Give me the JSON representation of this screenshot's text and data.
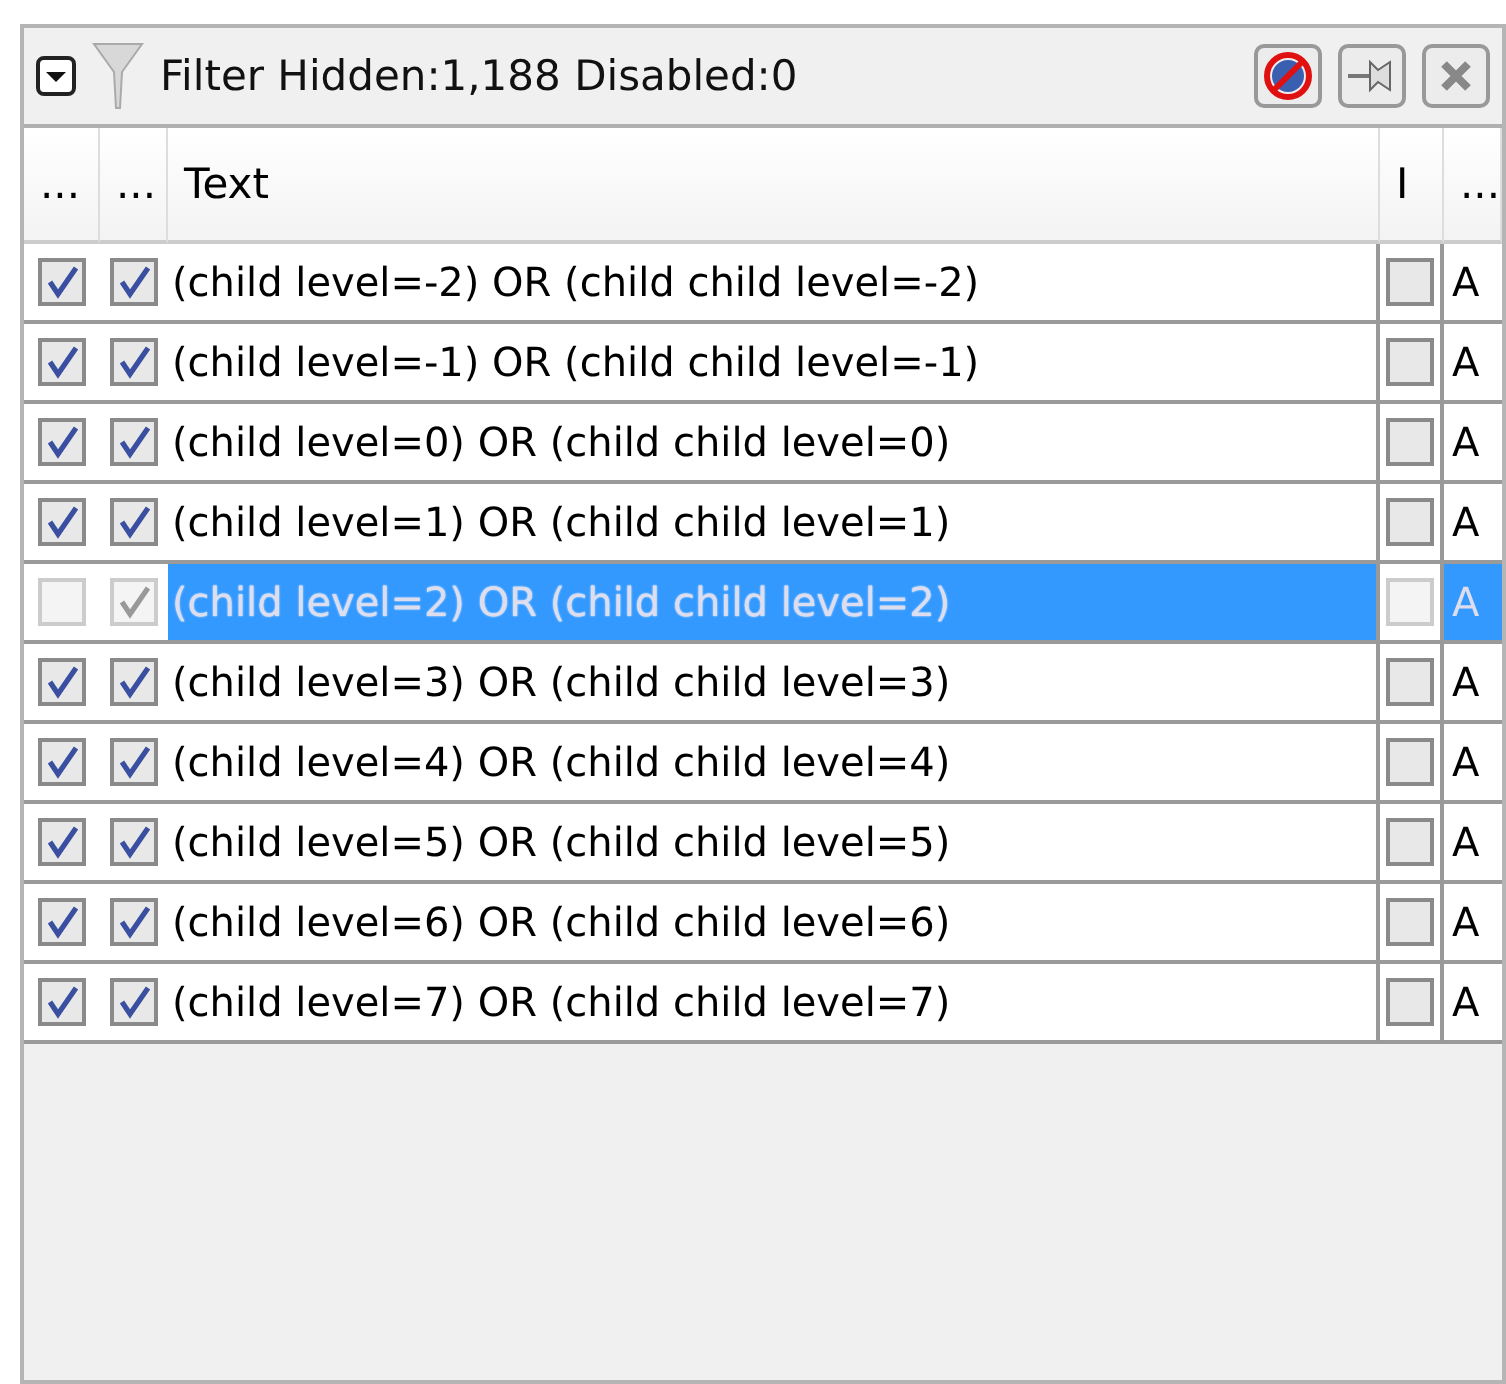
{
  "toolbar": {
    "expanded": true,
    "title": "Filter Hidden:1,188 Disabled:0"
  },
  "table": {
    "columns": [
      "...",
      "...",
      "Text",
      "I",
      "..."
    ],
    "rows": [
      {
        "enabled": true,
        "visible": true,
        "text": "(child level=-2) OR (child child level=-2)",
        "i_checked": false,
        "column_5": "A",
        "selected": false
      },
      {
        "enabled": true,
        "visible": true,
        "text": "(child level=-1) OR (child child level=-1)",
        "i_checked": false,
        "column_5": "A",
        "selected": false
      },
      {
        "enabled": true,
        "visible": true,
        "text": "(child level=0) OR (child child level=0)",
        "i_checked": false,
        "column_5": "A",
        "selected": false
      },
      {
        "enabled": true,
        "visible": true,
        "text": "(child level=1) OR (child child level=1)",
        "i_checked": false,
        "column_5": "A",
        "selected": false
      },
      {
        "enabled": false,
        "visible": true,
        "text": "(child level=2) OR (child child level=2)",
        "i_checked": false,
        "column_5": "A",
        "selected": true
      },
      {
        "enabled": true,
        "visible": true,
        "text": "(child level=3) OR (child child level=3)",
        "i_checked": false,
        "column_5": "A",
        "selected": false
      },
      {
        "enabled": true,
        "visible": true,
        "text": "(child level=4) OR (child child level=4)",
        "i_checked": false,
        "column_5": "A",
        "selected": false
      },
      {
        "enabled": true,
        "visible": true,
        "text": "(child level=5) OR (child child level=5)",
        "i_checked": false,
        "column_5": "A",
        "selected": false
      },
      {
        "enabled": true,
        "visible": true,
        "text": "(child level=6) OR (child child level=6)",
        "i_checked": false,
        "column_5": "A",
        "selected": false
      },
      {
        "enabled": true,
        "visible": true,
        "text": "(child level=7) OR (child child level=7)",
        "i_checked": false,
        "column_5": "A",
        "selected": false
      }
    ]
  }
}
